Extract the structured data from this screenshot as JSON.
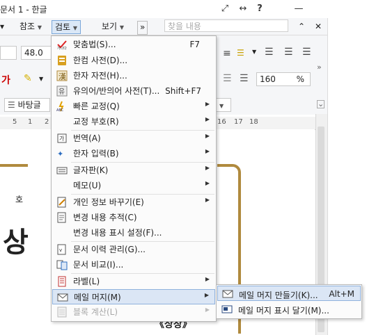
{
  "window": {
    "title": "문서 1 - 한글"
  },
  "titlebar_buttons": [
    "⤢",
    "↔",
    "?",
    "—"
  ],
  "menubar": {
    "items": [
      {
        "label": "참조"
      },
      {
        "label": "검토",
        "active": true
      },
      {
        "label": "보기"
      }
    ],
    "more": "»",
    "search_placeholder": "찾을 내용"
  },
  "toolbar": {
    "font_size": "48.0",
    "style_name": "바탕글",
    "zoom_value": "160",
    "zoom_unit": "%"
  },
  "ruler": {
    "ticks": [
      "5",
      "1",
      "2",
      "16",
      "17",
      "18"
    ]
  },
  "document": {
    "small_text": "호",
    "big_text": "상",
    "bottom_text": "《상장》"
  },
  "review_menu": {
    "items": [
      {
        "label": "맞춤법(S)...",
        "shortcut": "F7",
        "icon": "spellcheck-icon"
      },
      {
        "label": "한컴 사전(D)...",
        "icon": "dictionary-icon"
      },
      {
        "label": "한자 자전(H)...",
        "icon": "hanja-dictionary-icon"
      },
      {
        "label": "유의어/반의어 사전(T)...",
        "shortcut": "Shift+F7",
        "icon": "thesaurus-icon"
      },
      {
        "label": "빠른 교정(Q)",
        "submenu": true,
        "icon": "quick-correct-icon"
      },
      {
        "label": "교정 부호(R)",
        "submenu": true,
        "icon": ""
      },
      {
        "label": "번역(A)",
        "submenu": true,
        "icon": "translate-icon"
      },
      {
        "label": "한자 입력(B)",
        "submenu": true,
        "icon": "hanja-input-icon"
      },
      {
        "label": "글자판(K)",
        "submenu": true,
        "icon": "keyboard-icon"
      },
      {
        "label": "메모(U)",
        "submenu": true,
        "icon": ""
      },
      {
        "label": "개인 정보 바꾸기(E)",
        "submenu": true,
        "icon": "privacy-icon"
      },
      {
        "label": "변경 내용 추적(C)",
        "icon": "track-changes-icon"
      },
      {
        "label": "변경 내용 표시 설정(F)...",
        "icon": ""
      },
      {
        "label": "문서 이력 관리(G)...",
        "icon": "history-icon"
      },
      {
        "label": "문서 비교(I)...",
        "icon": "compare-icon"
      },
      {
        "label": "라벨(L)",
        "submenu": true,
        "icon": "label-icon"
      },
      {
        "label": "메일 머지(M)",
        "submenu": true,
        "highlighted": true,
        "icon": "mail-merge-icon"
      },
      {
        "label": "블록 계산(L)",
        "submenu": true,
        "disabled": true,
        "icon": "calculator-icon"
      }
    ]
  },
  "mail_merge_submenu": {
    "items": [
      {
        "label": "메일 머지 만들기(K)...",
        "shortcut": "Alt+M",
        "highlighted": true
      },
      {
        "label": "메일 머지 표시 달기(M)..."
      }
    ]
  },
  "colors": {
    "accent": "#4a7ec2",
    "highlight": "#dbe6f5",
    "border_gold": "#b08a3e"
  }
}
